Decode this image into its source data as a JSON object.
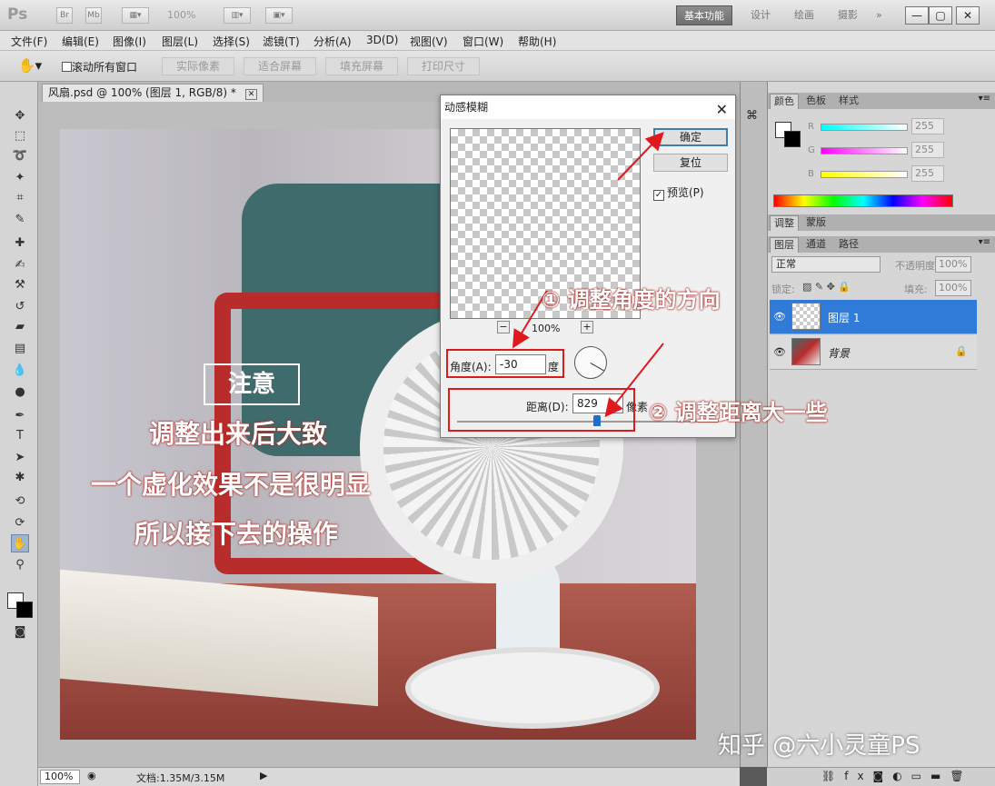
{
  "app": {
    "logo": "Ps",
    "zoom": "100%",
    "workspaces": [
      "基本功能",
      "设计",
      "绘画",
      "摄影",
      "»"
    ]
  },
  "menu": [
    "文件(F)",
    "编辑(E)",
    "图像(I)",
    "图层(L)",
    "选择(S)",
    "滤镜(T)",
    "分析(A)",
    "3D(D)",
    "视图(V)",
    "窗口(W)",
    "帮助(H)"
  ],
  "options": {
    "scroll_all": "滚动所有窗口",
    "buttons": [
      "实际像素",
      "适合屏幕",
      "填充屏幕",
      "打印尺寸"
    ]
  },
  "document": {
    "tab_title": "风扇.psd @ 100% (图层 1, RGB/8) *",
    "status_zoom": "100%",
    "status_doc": "文档:1.35M/3.15M"
  },
  "canvas_notes": {
    "box": "注意",
    "lines": [
      "调整出来后大致",
      "一个虚化效果不是很明显",
      "所以接下去的操作"
    ]
  },
  "dialog": {
    "title": "动感模糊",
    "ok": "确定",
    "reset": "复位",
    "preview_label": "预览(P)",
    "preview_checked": true,
    "zoom": "100%",
    "angle_label": "角度(A):",
    "angle_value": "-30",
    "angle_unit": "度",
    "distance_label": "距离(D):",
    "distance_value": "829",
    "distance_unit": "像素"
  },
  "annotations": {
    "step1": "① 调整角度的方向",
    "step2": "② 调整距离大一些"
  },
  "panels": {
    "color_tabs": [
      "颜色",
      "色板",
      "样式"
    ],
    "rgb": [
      {
        "label": "R",
        "value": "255"
      },
      {
        "label": "G",
        "value": "255"
      },
      {
        "label": "B",
        "value": "255"
      }
    ],
    "adjust_tabs": [
      "调整",
      "蒙版"
    ],
    "layer_tabs": [
      "图层",
      "通道",
      "路径"
    ],
    "blend_mode": "正常",
    "opacity_label": "不透明度:",
    "opacity": "100%",
    "lock_label": "锁定:",
    "fill_label": "填充:",
    "fill": "100%",
    "layers": [
      {
        "name": "图层 1",
        "selected": true
      },
      {
        "name": "背景",
        "selected": false
      }
    ]
  },
  "watermark": "知乎 @六小灵童PS",
  "colors": {
    "annotation_red": "#e0191e",
    "selection_blue": "#2f7bd7"
  }
}
